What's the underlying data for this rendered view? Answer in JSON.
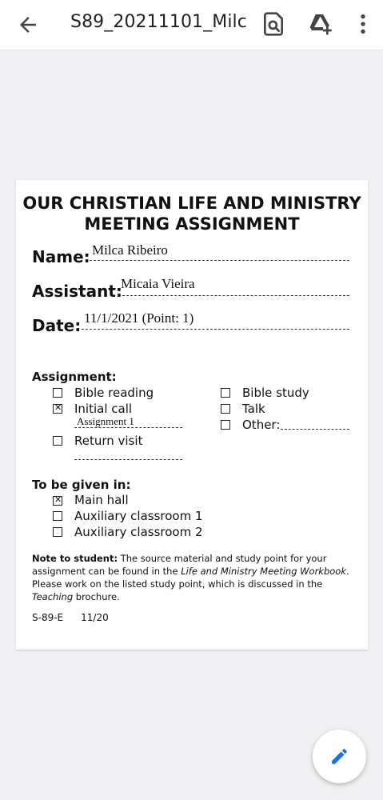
{
  "appbar": {
    "title": "S89_20211101_Milca...",
    "icons": [
      "back-arrow-icon",
      "find-in-document-icon",
      "add-to-drive-icon",
      "more-vertical-icon"
    ]
  },
  "form": {
    "heading_line1": "OUR CHRISTIAN LIFE AND MINISTRY",
    "heading_line2": "MEETING ASSIGNMENT",
    "name_label": "Name:",
    "name_value": "Milca Ribeiro",
    "assistant_label": "Assistant:",
    "assistant_value": "Micaia Vieira",
    "date_label": "Date:",
    "date_value": "11/1/2021  (Point:  1)",
    "assignment_label": "Assignment:",
    "assignment_options": [
      {
        "label": "Bible reading",
        "checked": false
      },
      {
        "label": "Initial call",
        "checked": true
      },
      {
        "label": "Return visit",
        "checked": false
      },
      {
        "label": "Bible study",
        "checked": false
      },
      {
        "label": "Talk",
        "checked": false
      },
      {
        "label": "Other:",
        "checked": false
      }
    ],
    "initial_call_note": "Assignment 1",
    "given_in_label": "To be given in:",
    "given_in_options": [
      {
        "label": "Main hall",
        "checked": true
      },
      {
        "label": "Auxiliary classroom 1",
        "checked": false
      },
      {
        "label": "Auxiliary classroom 2",
        "checked": false
      }
    ],
    "note": {
      "bold": "Note to student:",
      "part1": " The source material and study point for your assignment can be found in the ",
      "italic1": "Life and Ministry Meeting Workbook",
      "part2": ". Please work on the listed study point, which is discussed in the ",
      "italic2": "Teaching",
      "part3": " brochure."
    },
    "form_code": "S-89-E",
    "form_date": "11/20"
  },
  "fab": {
    "icon": "edit-pencil-icon"
  },
  "colors": {
    "accent": "#1a73e8",
    "background": "#f0f0f2"
  }
}
